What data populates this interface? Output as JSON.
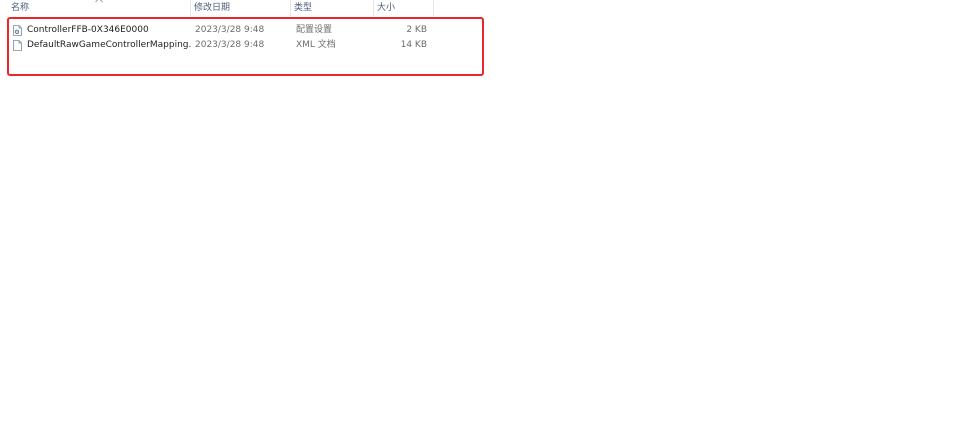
{
  "columns": {
    "name": "名称",
    "modified": "修改日期",
    "type": "类型",
    "size": "大小"
  },
  "icons": {
    "sort": "sort-ascending-caret-icon",
    "config_file": "config-file-icon",
    "xml_file": "xml-file-icon"
  },
  "colors": {
    "highlight_border": "#e8272b",
    "header_text": "#4c607a"
  },
  "files": [
    {
      "name": "ControllerFFB-0X346E0000",
      "modified": "2023/3/28 9:48",
      "type": "配置设置",
      "size": "2 KB"
    },
    {
      "name": "DefaultRawGameControllerMapping...",
      "modified": "2023/3/28 9:48",
      "type": "XML 文档",
      "size": "14 KB"
    }
  ]
}
